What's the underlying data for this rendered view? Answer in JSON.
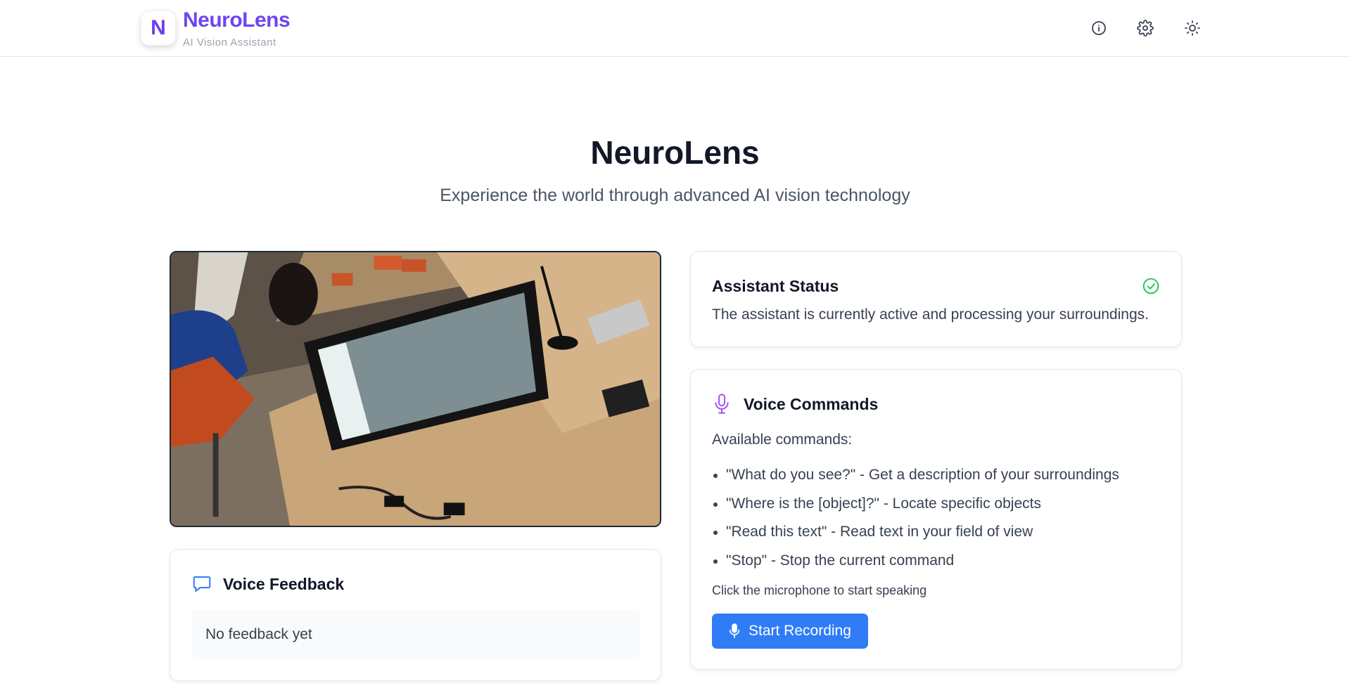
{
  "header": {
    "logo_letter": "N",
    "app_name": "NeuroLens",
    "app_subtitle": "AI Vision Assistant",
    "icons": [
      "info-icon",
      "settings-gear-icon",
      "theme-sun-icon"
    ]
  },
  "hero": {
    "title": "NeuroLens",
    "subtitle": "Experience the world through advanced AI vision technology"
  },
  "camera": {
    "description_icon": "live-camera-feed"
  },
  "status": {
    "title": "Assistant Status",
    "text": "The assistant is currently active and processing your surroundings.",
    "status_color": "#22c55e"
  },
  "voice_commands": {
    "title": "Voice Commands",
    "available_label": "Available commands:",
    "commands": [
      "\"What do you see?\" - Get a description of your surroundings",
      "\"Where is the [object]?\" - Locate specific objects",
      "\"Read this text\" - Read text in your field of view",
      "\"Stop\" - Stop the current command"
    ],
    "hint": "Click the microphone to start speaking",
    "button_label": "Start Recording",
    "accent": "#a855f7",
    "button_color": "#2f7cf6"
  },
  "voice_feedback": {
    "title": "Voice Feedback",
    "empty_text": "No feedback yet",
    "accent": "#3b82f6"
  }
}
